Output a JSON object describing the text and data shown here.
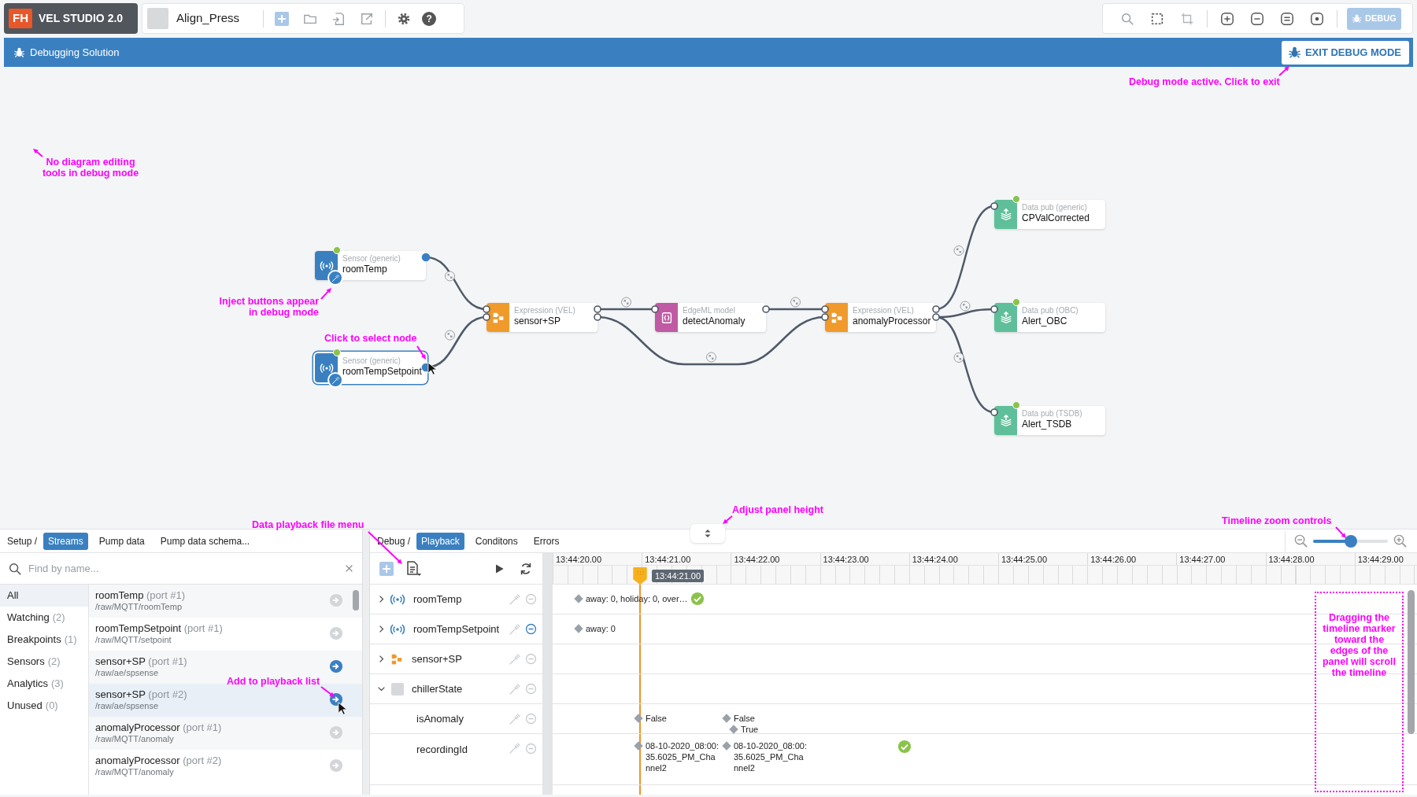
{
  "app": {
    "logo_mark": "FH",
    "title": "VEL STUDIO 2.0"
  },
  "project": {
    "name": "Align_Press",
    "help": "?"
  },
  "debug_button": {
    "label": "DEBUG"
  },
  "debug_bar": {
    "title": "Debugging Solution",
    "exit_button": "EXIT DEBUG MODE"
  },
  "nodes": [
    {
      "kind": "sensor",
      "type": "Sensor (generic)",
      "name": "roomTemp",
      "selected": false,
      "running": true,
      "inject": true
    },
    {
      "kind": "sensor",
      "type": "Sensor (generic)",
      "name": "roomTempSetpoint",
      "selected": true,
      "running": true,
      "inject": true
    },
    {
      "kind": "expression",
      "type": "Expression (VEL)",
      "name": "sensor+SP",
      "selected": false
    },
    {
      "kind": "model",
      "type": "EdgeML model",
      "name": "detectAnomaly",
      "selected": false
    },
    {
      "kind": "expression",
      "type": "Expression (VEL)",
      "name": "anomalyProcessor",
      "selected": false
    },
    {
      "kind": "datapub",
      "type": "Data pub (generic)",
      "name": "CPValCorrected",
      "selected": false,
      "running": true
    },
    {
      "kind": "datapub",
      "type": "Data pub (OBC)",
      "name": "Alert_OBC",
      "selected": false,
      "running": true
    },
    {
      "kind": "datapub",
      "type": "Data pub (TSDB)",
      "name": "Alert_TSDB",
      "selected": false,
      "running": true
    }
  ],
  "streams_panel": {
    "breadcrumb": "Setup /",
    "tabs": [
      {
        "label": "Streams",
        "selected": true
      },
      {
        "label": "Pump data",
        "selected": false
      },
      {
        "label": "Pump data schema...",
        "selected": false
      }
    ],
    "search": {
      "placeholder": "Find by name..."
    },
    "categories": [
      {
        "label": "All",
        "selected": true
      },
      {
        "label": "Watching",
        "count": "(2)",
        "selected": false
      },
      {
        "label": "Breakpoints",
        "count": "(1)",
        "selected": false
      },
      {
        "label": "Sensors",
        "count": "(2)",
        "selected": false
      },
      {
        "label": "Analytics",
        "count": "(3)",
        "selected": false
      },
      {
        "label": "Unused",
        "count": "(0)",
        "selected": false
      }
    ],
    "streams": [
      {
        "name": "roomTemp",
        "port": "(port #1)",
        "path": "/raw/MQTT/roomTemp",
        "selected": false,
        "active": false
      },
      {
        "name": "roomTempSetpoint",
        "port": "(port #1)",
        "path": "/raw/MQTT/setpoint",
        "selected": false,
        "active": false
      },
      {
        "name": "sensor+SP",
        "port": "(port #1)",
        "path": "/raw/ae/spsense",
        "selected": false,
        "active": true
      },
      {
        "name": "sensor+SP",
        "port": "(port #2)",
        "path": "/raw/ae/spsense",
        "selected": true,
        "active": true
      },
      {
        "name": "anomalyProcessor",
        "port": "(port #1)",
        "path": "/raw/MQTT/anomaly",
        "selected": false,
        "active": false
      },
      {
        "name": "anomalyProcessor",
        "port": "(port #2)",
        "path": "/raw/MQTT/anomaly",
        "selected": false,
        "active": false
      }
    ]
  },
  "playback_panel": {
    "breadcrumb": "Debug /",
    "tabs": [
      {
        "label": "Playback",
        "selected": true
      },
      {
        "label": "Conditons",
        "selected": false
      },
      {
        "label": "Errors",
        "selected": false
      }
    ],
    "zoom": {
      "level": 0.5
    },
    "ticks": [
      "13:44:20.00",
      "13:44:21.00",
      "13:44:22.00",
      "13:44:23.00",
      "13:44:24.00",
      "13:44:25.00",
      "13:44:26.00",
      "13:44:27.00",
      "13:44:28.00",
      "13:44:29.00"
    ],
    "marker": "13:44:21.00",
    "items": [
      {
        "kind": "sensor",
        "name": "roomTemp",
        "expanded": false,
        "breakpoint": false,
        "events": [
          {
            "kind": "value",
            "text": "away: 0, holiday: 0, over…"
          },
          {
            "kind": "ok"
          }
        ]
      },
      {
        "kind": "sensor",
        "name": "roomTempSetpoint",
        "expanded": false,
        "breakpoint": true,
        "events": [
          {
            "kind": "value",
            "text": "away: 0"
          }
        ]
      },
      {
        "kind": "expression",
        "name": "sensor+SP",
        "expanded": false,
        "breakpoint": false
      },
      {
        "kind": "group",
        "name": "chillerState",
        "expanded": true,
        "breakpoint": false,
        "children": [
          {
            "kind": "field",
            "name": "isAnomaly",
            "breakpoint": false,
            "events": [
              {
                "kind": "value",
                "text": "False"
              },
              {
                "kind": "value",
                "text": "False"
              },
              {
                "kind": "value",
                "text": "True"
              }
            ]
          },
          {
            "kind": "field",
            "name": "recordingId",
            "breakpoint": false,
            "events": [
              {
                "kind": "value",
                "text": "08-10-2020_08:00:35.6025_PM_Channel2"
              },
              {
                "kind": "value",
                "text": "08-10-2020_08:00:35.6025_PM_Channel2"
              },
              {
                "kind": "ok"
              }
            ]
          }
        ]
      }
    ]
  },
  "annotations": [
    {
      "kind": "arrow",
      "text": "Debug mode active. Click to exit"
    },
    {
      "kind": "arrow",
      "text": "No diagram editing tools in debug mode"
    },
    {
      "kind": "arrow",
      "text": "Inject buttons appear in debug mode"
    },
    {
      "kind": "arrow",
      "text": "Click to select node"
    },
    {
      "kind": "arrow",
      "text": "Data playback file menu"
    },
    {
      "kind": "arrow",
      "text": "Adjust panel height"
    },
    {
      "kind": "arrow",
      "text": "Timeline zoom controls"
    },
    {
      "kind": "arrow",
      "text": "Add to playback list"
    },
    {
      "kind": "box",
      "text": "Dragging the timeline marker toward the edges of the panel will scroll the timeline"
    }
  ]
}
